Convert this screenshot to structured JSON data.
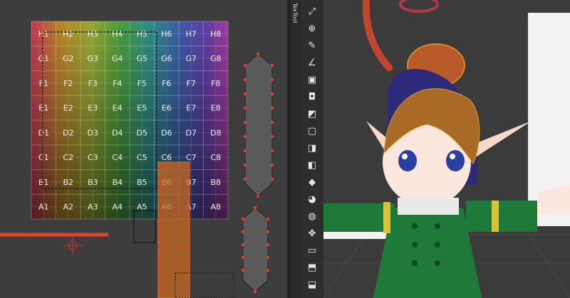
{
  "toolbar": {
    "label": "TexTool"
  },
  "uv_grid": {
    "rows": [
      [
        "H1",
        "H2",
        "H3",
        "H4",
        "H5",
        "H6",
        "H7",
        "H8"
      ],
      [
        "G1",
        "G2",
        "G3",
        "G4",
        "G5",
        "G6",
        "G7",
        "G8"
      ],
      [
        "F1",
        "F2",
        "F3",
        "F4",
        "F5",
        "F6",
        "F7",
        "F8"
      ],
      [
        "E1",
        "E2",
        "E3",
        "E4",
        "E5",
        "E6",
        "E7",
        "E8"
      ],
      [
        "D1",
        "D2",
        "D3",
        "D4",
        "D5",
        "D6",
        "D7",
        "D8"
      ],
      [
        "C1",
        "C2",
        "C3",
        "C4",
        "C5",
        "C6",
        "C7",
        "C8"
      ],
      [
        "B1",
        "B2",
        "B3",
        "B4",
        "B5",
        "B6",
        "B7",
        "B8"
      ],
      [
        "A1",
        "A2",
        "A3",
        "A4",
        "A5",
        "A6",
        "A7",
        "A8"
      ]
    ],
    "column_colors": [
      "#c23a52",
      "#b8862a",
      "#9aa834",
      "#4a9e3c",
      "#2f8c86",
      "#3b5ea6",
      "#5d3fa6",
      "#a23a9c"
    ]
  },
  "tools": [
    {
      "name": "maximize-icon"
    },
    {
      "name": "move-view-icon"
    },
    {
      "name": "pencil-icon"
    },
    {
      "name": "angle-icon"
    },
    {
      "name": "cube-icon"
    },
    {
      "name": "cube-inset-icon"
    },
    {
      "name": "cube-cut-icon"
    },
    {
      "name": "cube-front-icon"
    },
    {
      "name": "cube-side-icon"
    },
    {
      "name": "cube-half-icon"
    },
    {
      "name": "vertex-snap-icon"
    },
    {
      "name": "color-wheel-icon"
    },
    {
      "name": "sphere-icon"
    },
    {
      "name": "move-arrows-icon"
    },
    {
      "name": "cube-outline-icon"
    },
    {
      "name": "flat-cube-icon"
    },
    {
      "name": "open-box-icon"
    }
  ]
}
